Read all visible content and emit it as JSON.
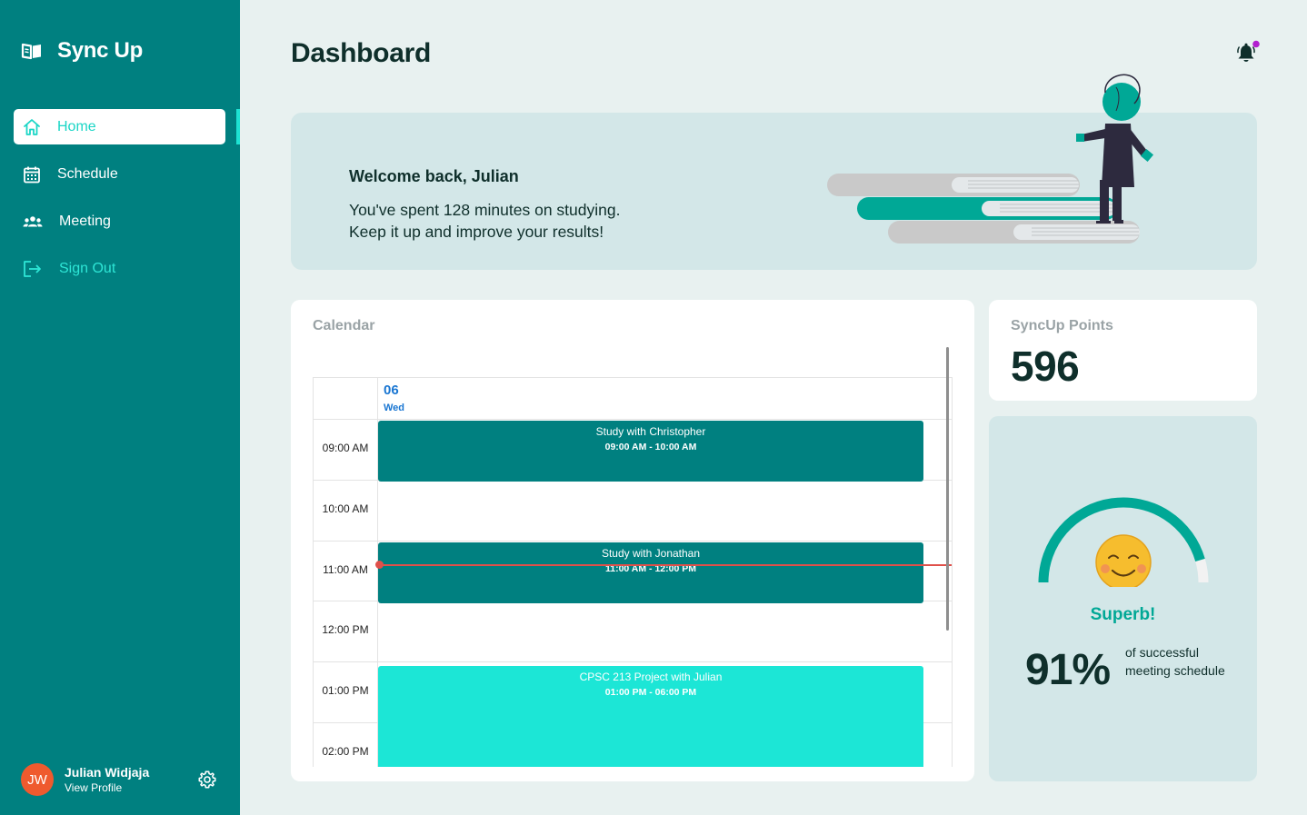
{
  "app": {
    "name": "Sync Up"
  },
  "sidebar": {
    "items": [
      {
        "label": "Home",
        "icon": "home-icon",
        "active": true
      },
      {
        "label": "Schedule",
        "icon": "calendar-icon",
        "active": false
      },
      {
        "label": "Meeting",
        "icon": "people-icon",
        "active": false
      },
      {
        "label": "Sign Out",
        "icon": "sign-out-icon",
        "active": false
      }
    ],
    "profile": {
      "initials": "JW",
      "name": "Julian Widjaja",
      "link": "View Profile"
    }
  },
  "header": {
    "title": "Dashboard"
  },
  "welcome": {
    "title": "Welcome back, Julian",
    "line1": "You've spent 128 minutes on studying.",
    "line2": "Keep it up and improve your results!"
  },
  "calendar": {
    "title": "Calendar",
    "day": {
      "number": "06",
      "name": "Wed"
    },
    "hours": [
      "09:00 AM",
      "10:00 AM",
      "11:00 AM",
      "12:00 PM",
      "01:00 PM",
      "02:00 PM"
    ],
    "events": [
      {
        "title": "Study with Christopher",
        "time": "09:00 AM - 10:00 AM"
      },
      {
        "title": "Study with Jonathan",
        "time": "11:00 AM - 12:00 PM"
      },
      {
        "title": "CPSC 213 Project with Julian",
        "time": "01:00 PM - 06:00 PM"
      }
    ]
  },
  "points": {
    "title": "SyncUp Points",
    "value": "596"
  },
  "score": {
    "word": "Superb!",
    "percent": "91%",
    "percent_value": 0.91,
    "description": "of successful meeting schedule"
  },
  "colors": {
    "sidebar": "#008080",
    "accent": "#1ce6d6",
    "event_dark": "#008080",
    "event_bright": "#1ce6d6",
    "gauge": "#00a896",
    "now_line": "#e0504a",
    "avatar": "#ef5a2e"
  }
}
